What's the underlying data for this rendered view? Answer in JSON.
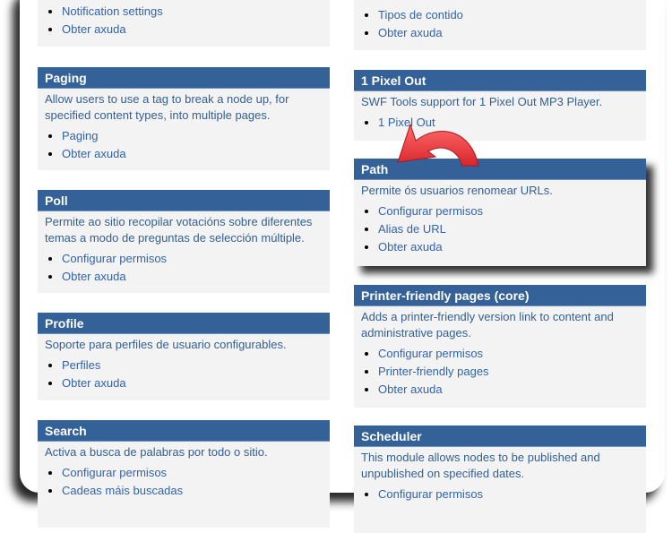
{
  "left_column": [
    {
      "title": "",
      "desc": "",
      "links": [
        "Notification settings",
        "Obter axuda"
      ]
    },
    {
      "title": "Paging",
      "desc": "Allow users to use a tag to break a node up, for specified content types, into multiple pages.",
      "links": [
        "Paging",
        "Obter axuda"
      ]
    },
    {
      "title": "Poll",
      "desc": "Permite ao sitio recopilar votacións sobre diferentes temas a modo de preguntas de selección múltiple.",
      "links": [
        "Configurar permisos",
        "Obter axuda"
      ]
    },
    {
      "title": "Profile",
      "desc": "Soporte para perfiles de usuario configurables.",
      "links": [
        "Perfiles",
        "Obter axuda"
      ]
    },
    {
      "title": "Search",
      "desc": "Activa a busca de palabras por todo o sitio.",
      "links": [
        "Configurar permisos",
        "Cadeas máis buscadas"
      ]
    }
  ],
  "right_column": [
    {
      "title": "",
      "desc": "",
      "links": [
        "Tipos de contido",
        "Obter axuda"
      ]
    },
    {
      "title": "1 Pixel Out",
      "desc": "SWF Tools support for 1 Pixel Out MP3 Player.",
      "links": [
        "1 Pixel Out"
      ]
    },
    {
      "title": "Path",
      "desc": "Permite ós usuarios renomear URLs.",
      "links": [
        "Configurar permisos",
        "Alias de URL",
        "Obter axuda"
      ]
    },
    {
      "title": "Printer-friendly pages (core)",
      "desc": "Adds a printer-friendly version link to content and administrative pages.",
      "links": [
        "Configurar permisos",
        "Printer-friendly pages",
        "Obter axuda"
      ]
    },
    {
      "title": "Scheduler",
      "desc": "This module allows nodes to be published and unpublished on specified dates.",
      "links": [
        "Configurar permisos"
      ]
    }
  ],
  "colors": {
    "header": "#336198",
    "link": "#3363a8",
    "arrow": "#e8373c"
  },
  "annotation": {
    "icon": "curved-arrow-icon"
  }
}
